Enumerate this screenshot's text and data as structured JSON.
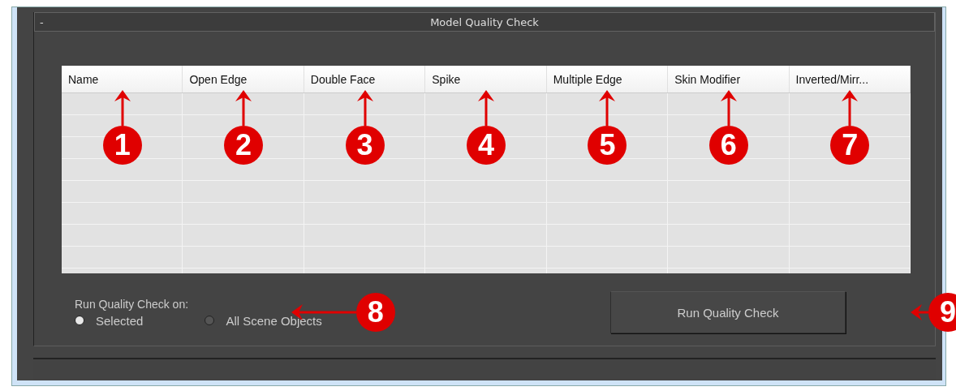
{
  "rollout": {
    "collapse": "-",
    "title": "Model Quality Check"
  },
  "table": {
    "columns": [
      {
        "label": "Name",
        "callout": "1"
      },
      {
        "label": "Open Edge",
        "callout": "2"
      },
      {
        "label": "Double Face",
        "callout": "3"
      },
      {
        "label": "Spike",
        "callout": "4"
      },
      {
        "label": "Multiple Edge",
        "callout": "5"
      },
      {
        "label": "Skin Modifier",
        "callout": "6"
      },
      {
        "label": "Inverted/Mirr...",
        "callout": "7"
      }
    ]
  },
  "run_on": {
    "label": "Run Quality Check on:",
    "callout": "8",
    "options": [
      {
        "label": "Selected",
        "selected": true
      },
      {
        "label": "All Scene Objects",
        "selected": false
      }
    ]
  },
  "run_button": {
    "label": "Run Quality Check",
    "callout": "9"
  }
}
